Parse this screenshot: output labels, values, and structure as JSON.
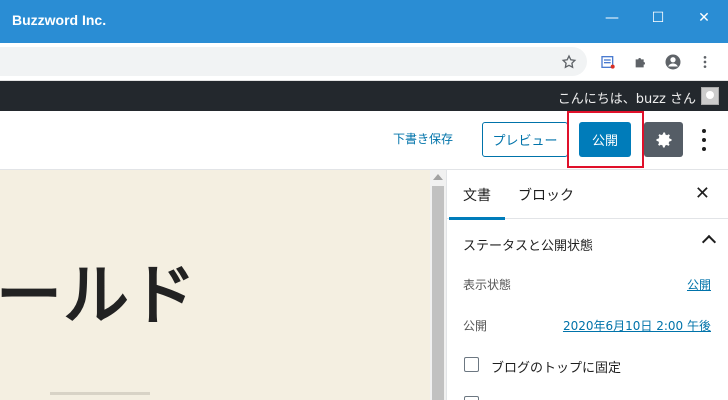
{
  "window": {
    "title": "Buzzword Inc.",
    "minimize": "—",
    "maximize": "☐",
    "close": "✕"
  },
  "toolbar": {
    "icons": [
      "star-icon",
      "extension-list-icon",
      "puzzle-icon",
      "account-icon",
      "kebab-icon"
    ]
  },
  "adminbar": {
    "greeting": "こんにちは、buzz さん"
  },
  "editor_header": {
    "save_draft": "下書き保存",
    "preview": "プレビュー",
    "publish": "公開"
  },
  "canvas": {
    "heading": "ールド"
  },
  "sidebar": {
    "tabs": [
      {
        "label": "文書",
        "active": true
      },
      {
        "label": "ブロック",
        "active": false
      }
    ],
    "close": "✕",
    "panel": {
      "title": "ステータスと公開状態",
      "rows": [
        {
          "label": "表示状態",
          "value": "公開"
        },
        {
          "label": "公開",
          "value": "2020年6月10日 2:00 午後"
        }
      ],
      "sticky_label": "ブログのトップに固定"
    }
  },
  "colors": {
    "titlebar": "#2a8dd4",
    "adminbar": "#23282d",
    "accent": "#007cba",
    "highlight": "#e0102a",
    "canvas": "#f4efe1"
  }
}
